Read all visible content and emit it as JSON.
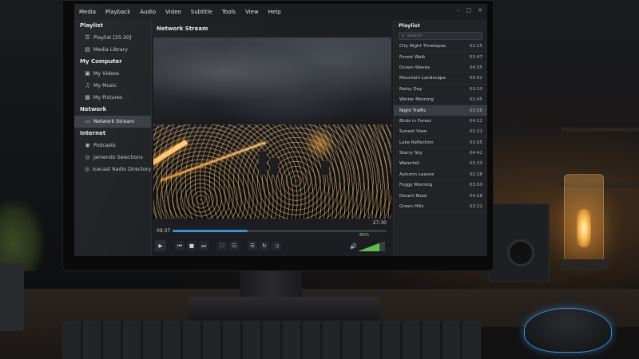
{
  "menubar": {
    "items": [
      "Media",
      "Playback",
      "Audio",
      "Video",
      "Subtitle",
      "Tools",
      "View",
      "Help"
    ]
  },
  "sidebar": {
    "sections": [
      {
        "heading": "Playlist",
        "items": [
          {
            "label": "Playlist [25:30]",
            "icon": "playlist-icon"
          },
          {
            "label": "Media Library",
            "icon": "library-icon"
          }
        ]
      },
      {
        "heading": "My Computer",
        "items": [
          {
            "label": "My Videos",
            "icon": "video-folder-icon"
          },
          {
            "label": "My Music",
            "icon": "music-note-icon"
          },
          {
            "label": "My Pictures",
            "icon": "picture-icon"
          }
        ]
      },
      {
        "heading": "Network",
        "items": [
          {
            "label": "Network Stream",
            "icon": "monitor-icon",
            "active": true
          }
        ]
      },
      {
        "heading": "Internet",
        "items": [
          {
            "label": "Podcasts",
            "icon": "podcast-icon"
          },
          {
            "label": "Jamendo Selections",
            "icon": "globe-icon"
          },
          {
            "label": "Icecast Radio Directory",
            "icon": "radio-icon"
          }
        ]
      }
    ]
  },
  "player": {
    "title": "Network Stream",
    "time_current": "09:37",
    "time_total": "27:30",
    "progress": 0.35,
    "volume_label": "80%",
    "volume": 0.8
  },
  "playlist": {
    "title": "Playlist",
    "search_placeholder": "Search",
    "items": [
      {
        "title": "City Night Timelapse",
        "duration": "02:15"
      },
      {
        "title": "Forest Walk",
        "duration": "03:47"
      },
      {
        "title": "Ocean Waves",
        "duration": "04:35"
      },
      {
        "title": "Mountain Landscape",
        "duration": "05:02"
      },
      {
        "title": "Rainy Day",
        "duration": "03:10"
      },
      {
        "title": "Winter Morning",
        "duration": "02:45"
      },
      {
        "title": "Night Traffic",
        "duration": "03:58",
        "active": true
      },
      {
        "title": "Birds in Forest",
        "duration": "04:12"
      },
      {
        "title": "Sunset View",
        "duration": "02:31"
      },
      {
        "title": "Lake Reflection",
        "duration": "03:05"
      },
      {
        "title": "Starry Sky",
        "duration": "04:42"
      },
      {
        "title": "Waterfall",
        "duration": "03:33"
      },
      {
        "title": "Autumn Leaves",
        "duration": "02:28"
      },
      {
        "title": "Foggy Morning",
        "duration": "03:50"
      },
      {
        "title": "Desert Road",
        "duration": "04:18"
      },
      {
        "title": "Green Hills",
        "duration": "03:22"
      }
    ]
  },
  "colors": {
    "accent": "#3c8fd1",
    "volume": "#5cbf4a"
  }
}
